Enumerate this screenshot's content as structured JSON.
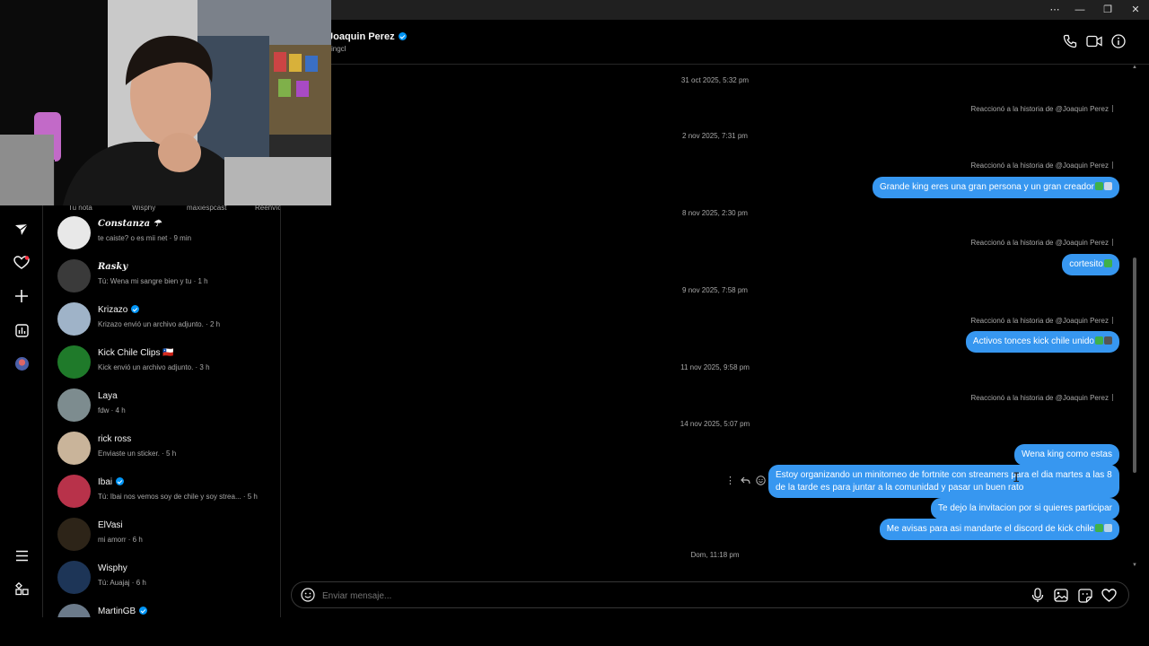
{
  "window": {
    "controls": [
      "⋯",
      "—",
      "❐",
      "✕"
    ]
  },
  "notes_row": [
    "Tu nota",
    "Wisphy",
    "maxiespcast",
    "Reenvío"
  ],
  "threads": [
    {
      "name": "𝑪𝒐𝒏𝒔𝒕𝒂𝒏𝒛𝒂 ☂",
      "script": true,
      "verified": false,
      "preview": "te caiste? o es mii net · 9 min",
      "avatar_color": "#e8e8e8"
    },
    {
      "name": "𝑹𝒂𝒔𝒌𝒚",
      "script": true,
      "verified": false,
      "preview": "Tú: Wena mi sangre bien y tu · 1 h",
      "avatar_color": "#3a3a3a"
    },
    {
      "name": "Krizazo",
      "script": false,
      "verified": true,
      "preview": "Krizazo envió un archivo adjunto. · 2 h",
      "avatar_color": "#9fb3c8"
    },
    {
      "name": "Kick Chile Clips 🇨🇱",
      "script": false,
      "verified": false,
      "preview": "Kick envió un archivo adjunto. · 3 h",
      "avatar_color": "#1f7a2a"
    },
    {
      "name": "Laya",
      "script": false,
      "verified": false,
      "preview": "fdw · 4 h",
      "avatar_color": "#7d8c8f"
    },
    {
      "name": "rick ross",
      "script": false,
      "verified": false,
      "preview": "Enviaste un sticker. · 5 h",
      "avatar_color": "#c9b49a"
    },
    {
      "name": "Ibai",
      "script": false,
      "verified": true,
      "preview": "Tú: Ibai nos vemos soy de chile y soy strea... · 5 h",
      "avatar_color": "#b8324a"
    },
    {
      "name": "ElVasi",
      "script": false,
      "verified": false,
      "preview": "mi amorr · 6 h",
      "avatar_color": "#2d2418"
    },
    {
      "name": "Wisphy",
      "script": false,
      "verified": false,
      "preview": "Tú: Auajaj · 6 h",
      "avatar_color": "#1d3557"
    },
    {
      "name": "MartinGB",
      "script": false,
      "verified": true,
      "preview": "",
      "avatar_color": "#6b7a8a"
    }
  ],
  "header": {
    "name": "Joaquin Perez",
    "username": "kingcl"
  },
  "messages": {
    "ts1": "31 oct 2025, 5:32 pm",
    "react1": "Reaccionó a la historia de @Joaquin Perez",
    "ts2": "2 nov 2025, 7:31 pm",
    "react2": "Reaccionó a la historia de @Joaquin Perez",
    "bubble1": "Grande king eres una gran persona y un gran creador",
    "ts3": "8 nov 2025, 2:30 pm",
    "react3": "Reaccionó a la historia de @Joaquin Perez",
    "bubble2": "cortesito",
    "ts4": "9 nov 2025, 7:58 pm",
    "react4": "Reaccionó a la historia de @Joaquin Perez",
    "bubble3": "Activos tonces kick chile unido",
    "ts5": "11 nov 2025, 9:58 pm",
    "react5": "Reaccionó a la historia de @Joaquin Perez",
    "ts6": "14 nov 2025, 5:07 pm",
    "bubble4": "Wena king como estas",
    "bubble5": "Estoy organizando un minitorneo de fortnite con streamers para el dia martes a las 8 de la tarde es para juntar a la comunidad y pasar un buen rato",
    "bubble6": "Te dejo la invitacion por si quieres participar",
    "bubble7": "Me avisas para asi mandarte el discord de kick chile",
    "ts7": "Dom, 11:18 pm"
  },
  "composer": {
    "placeholder": "Enviar mensaje..."
  },
  "colors": {
    "bubble": "#3797f0",
    "verified": "#0095f6",
    "emoji_green": "#3fb14a",
    "notification": "#ff3040"
  }
}
